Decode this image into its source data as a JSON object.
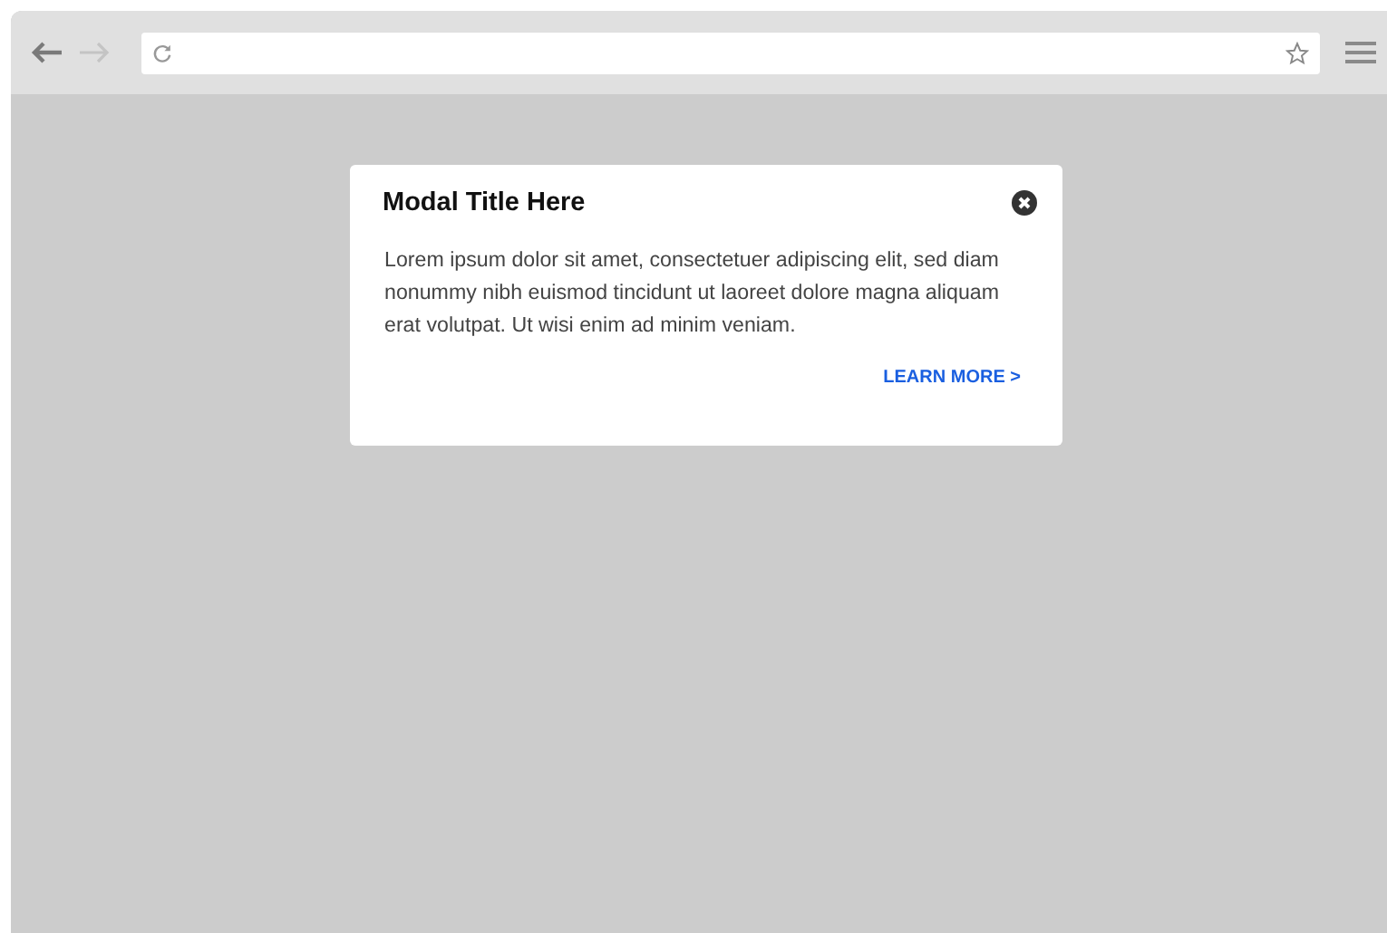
{
  "browser": {
    "back": {
      "disabled": false
    },
    "forward": {
      "disabled": true
    }
  },
  "modal": {
    "title": "Modal Title Here",
    "body": "Lorem ipsum dolor sit amet, consectetuer adipiscing elit, sed diam nonummy nibh euismod tincidunt ut laoreet dolore magna aliquam erat volutpat. Ut wisi enim ad minim veniam.",
    "link": "LEARN MORE >"
  }
}
